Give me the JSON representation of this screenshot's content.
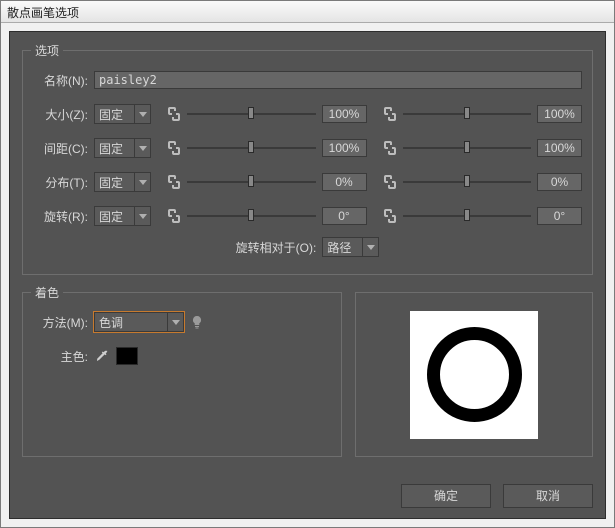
{
  "window": {
    "title": "散点画笔选项"
  },
  "options": {
    "legend": "选项",
    "name_label": "名称(N):",
    "name_value": "paisley2",
    "rows": [
      {
        "label": "大小(Z):",
        "mode": "固定",
        "v1": "100%",
        "v2": "100%",
        "p1": 50,
        "p2": 50,
        "linked": true
      },
      {
        "label": "间距(C):",
        "mode": "固定",
        "v1": "100%",
        "v2": "100%",
        "p1": 50,
        "p2": 50,
        "linked": true
      },
      {
        "label": "分布(T):",
        "mode": "固定",
        "v1": "0%",
        "v2": "0%",
        "p1": 50,
        "p2": 50,
        "linked": true
      },
      {
        "label": "旋转(R):",
        "mode": "固定",
        "v1": "0°",
        "v2": "0°",
        "p1": 50,
        "p2": 50,
        "linked": true
      }
    ],
    "rotation_relative_label": "旋转相对于(O):",
    "rotation_relative_value": "路径"
  },
  "colorization": {
    "legend": "着色",
    "method_label": "方法(M):",
    "method_value": "色调",
    "key_label": "主色:",
    "key_color": "#000000"
  },
  "buttons": {
    "ok": "确定",
    "cancel": "取消"
  }
}
